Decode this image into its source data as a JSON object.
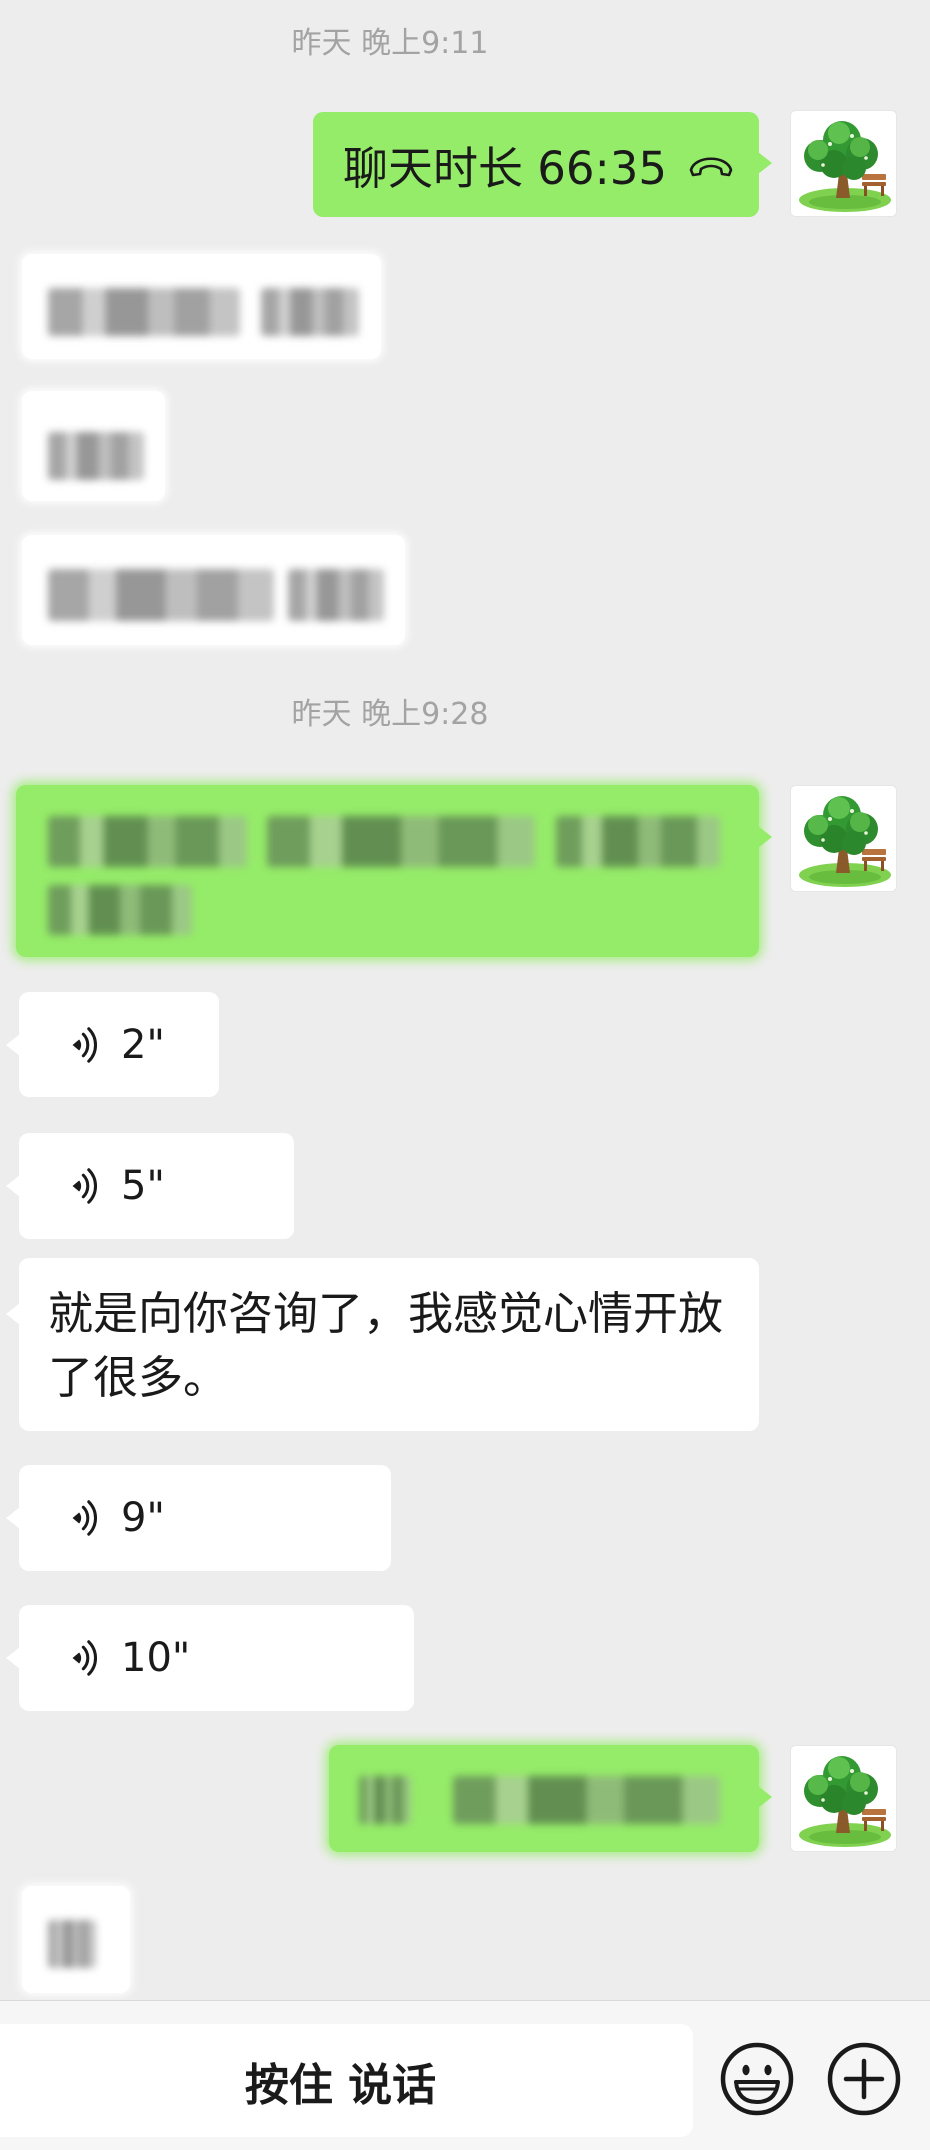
{
  "colors": {
    "chat_background": "#ededed",
    "sent_bubble": "#95ec69",
    "received_bubble": "#ffffff",
    "timestamp_text": "#a3a3a3",
    "input_bar_background": "#f6f6f6"
  },
  "timestamps": [
    "昨天 晚上9:11",
    "昨天 晚上9:28"
  ],
  "call_record": {
    "label": "聊天时长 66:35",
    "icon": "hang-up-phone-icon"
  },
  "voice_messages": [
    {
      "duration": "2\"",
      "icon": "voice-wave-icon"
    },
    {
      "duration": "5\"",
      "icon": "voice-wave-icon"
    },
    {
      "duration": "9\"",
      "icon": "voice-wave-icon"
    },
    {
      "duration": "10\"",
      "icon": "voice-wave-icon"
    }
  ],
  "text_messages": [
    {
      "text": "就是向你咨询了，我感觉心情开放了很多。"
    }
  ],
  "avatar": {
    "icon": "tree-avatar-icon"
  },
  "input_bar": {
    "talk_button_label": "按住 说话",
    "emoji_icon": "emoji-face-icon",
    "more_icon": "plus-circle-icon"
  }
}
